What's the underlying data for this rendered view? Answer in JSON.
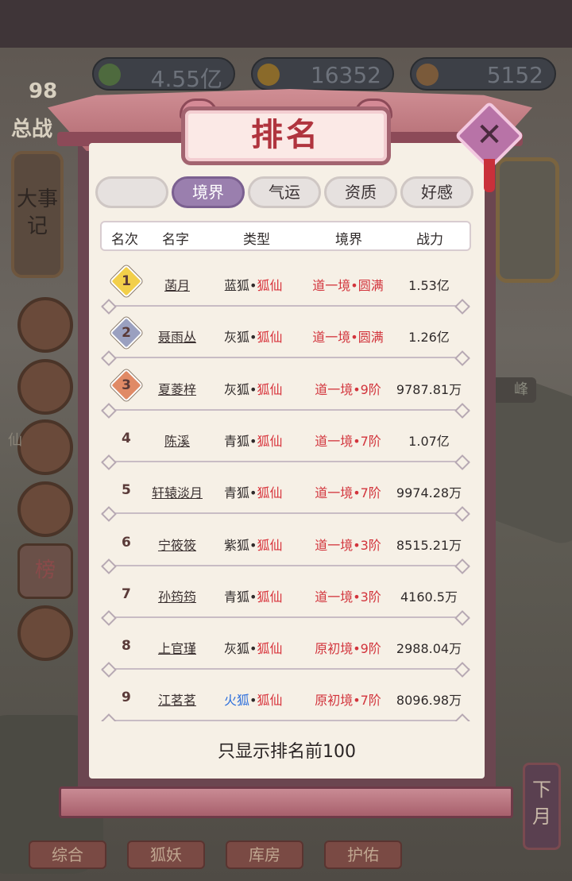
{
  "currency": [
    {
      "icon": "jade-icon",
      "value": "4.55亿"
    },
    {
      "icon": "gold-icon",
      "value": "16352"
    },
    {
      "icon": "ingot-icon",
      "value": "5152"
    }
  ],
  "side": {
    "level": "98",
    "power_label": "总战",
    "chronicle": "大事记",
    "ranking_icon_label": "榜",
    "peak_label": "峰",
    "month_button": "下月",
    "mountain_label": "仙"
  },
  "bottom_tabs": [
    "综合",
    "狐妖",
    "库房",
    "护佑"
  ],
  "panel": {
    "title": "排名",
    "tabs": [
      "",
      "境界",
      "气运",
      "资质",
      "好感"
    ],
    "active_tab": 1,
    "columns": [
      "名次",
      "名字",
      "类型",
      "境界",
      "战力"
    ],
    "rows": [
      {
        "rank": "1",
        "name": "菡月",
        "fox": "蓝狐",
        "kind": "狐仙",
        "realm": "道一境•圆满",
        "power": "1.53亿",
        "medal": "gold",
        "fox_color": "normal"
      },
      {
        "rank": "2",
        "name": "聂雨丛",
        "fox": "灰狐",
        "kind": "狐仙",
        "realm": "道一境•圆满",
        "power": "1.26亿",
        "medal": "silver",
        "fox_color": "normal"
      },
      {
        "rank": "3",
        "name": "夏菱梓",
        "fox": "灰狐",
        "kind": "狐仙",
        "realm": "道一境•9阶",
        "power": "9787.81万",
        "medal": "bronze",
        "fox_color": "normal"
      },
      {
        "rank": "4",
        "name": "陈溪",
        "fox": "青狐",
        "kind": "狐仙",
        "realm": "道一境•7阶",
        "power": "1.07亿",
        "medal": "",
        "fox_color": "normal"
      },
      {
        "rank": "5",
        "name": "轩辕淡月",
        "fox": "青狐",
        "kind": "狐仙",
        "realm": "道一境•7阶",
        "power": "9974.28万",
        "medal": "",
        "fox_color": "normal"
      },
      {
        "rank": "6",
        "name": "宁筱筱",
        "fox": "紫狐",
        "kind": "狐仙",
        "realm": "道一境•3阶",
        "power": "8515.21万",
        "medal": "",
        "fox_color": "normal"
      },
      {
        "rank": "7",
        "name": "孙筠筠",
        "fox": "青狐",
        "kind": "狐仙",
        "realm": "道一境•3阶",
        "power": "4160.5万",
        "medal": "",
        "fox_color": "normal"
      },
      {
        "rank": "8",
        "name": "上官瑾",
        "fox": "灰狐",
        "kind": "狐仙",
        "realm": "原初境•9阶",
        "power": "2988.04万",
        "medal": "",
        "fox_color": "normal"
      },
      {
        "rank": "9",
        "name": "江茗茗",
        "fox": "火狐",
        "kind": "狐仙",
        "realm": "原初境•7阶",
        "power": "8096.98万",
        "medal": "",
        "fox_color": "fire"
      }
    ],
    "footer": "只显示排名前100"
  },
  "colors": {
    "gold_medal": "#f2cf4a",
    "silver_medal": "#9aa0c0",
    "bronze_medal": "#e08a66",
    "accent_red": "#d2343c",
    "active_tab": "#9a7fae"
  }
}
